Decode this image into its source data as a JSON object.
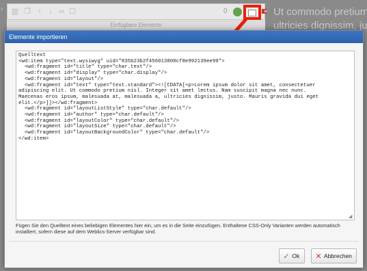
{
  "background": {
    "text_lines": [
      "Ut commodo pretium",
      "ultricies dignissim, ju"
    ],
    "toolbar": {
      "element_count": "0",
      "sub_label": "Einfügbare Elemente"
    }
  },
  "dialog": {
    "title": "Elemente importieren",
    "source_text": "Quelltext\n<wd:item type=\"text.wysiwyg\" uid=\"835b23b2f456013800cf8e992139ee99\">\n  <wd:fragment id=\"title\" type=\"char.text\"/>\n  <wd:fragment id=\"display\" type=\"char.display\"/>\n  <wd:fragment id=\"layout\"/>\n  <wd:fragment id=\"text\" type=\"text.standard\"><![CDATA[<p>Lorem ipsum dolor sit amet, consectetuer\nadipiscing elit. Ut commodo pretium nisl. Integer sit amet lectus. Nam suscipit magna nec nunc.\nMaecenas eros ipsum, malesuada at, malesuada a, ultricies dignissim, justo. Mauris gravida dui eget\nelit.</p>]]></wd:fragment>\n  <wd:fragment id=\"layoutListStyle\" type=\"char.default\"/>\n  <wd:fragment id=\"author\" type=\"char.default\"/>\n  <wd:fragment id=\"layoutColor\" type=\"char.default\"/>\n  <wd:fragment id=\"layoutSize\" type=\"char.default\"/>\n  <wd:fragment id=\"layoutBackgroundColor\" type=\"char.default\"/>\n</wd:item>",
    "help_text": "Fügen Sie den Quelltext eines beliebigen Elementes hier ein, um es in die Seite einzufügen. Enthaltene CSS-Only Varianten werden automatisch installiert, sofern diese auf dem Weblics-Server verfügbar sind.",
    "ok_label": "Ok",
    "cancel_label": "Abbrechen"
  },
  "colors": {
    "title_bar": "#2e62ad",
    "highlight": "#e8200a",
    "ok_icon": "#3a9a2b",
    "cancel_icon": "#d23a2a"
  },
  "icons": {
    "ok": "checkmark-icon",
    "cancel": "x-icon",
    "import": "import-icon"
  }
}
